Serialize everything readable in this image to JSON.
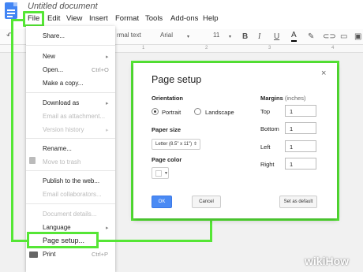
{
  "document": {
    "title": "Untitled document"
  },
  "menubar": [
    "File",
    "Edit",
    "View",
    "Insert",
    "Format",
    "Tools",
    "Add-ons",
    "Help"
  ],
  "toolbar": {
    "style": "rmal text",
    "font": "Arial",
    "size": "11"
  },
  "ruler": [
    "1",
    "2",
    "3",
    "4"
  ],
  "file_menu": {
    "items": [
      {
        "label": "Share...",
        "disabled": false
      },
      {
        "label": "New",
        "submenu": true
      },
      {
        "label": "Open...",
        "shortcut": "Ctrl+O"
      },
      {
        "label": "Make a copy..."
      },
      {
        "label": "Download as",
        "submenu": true
      },
      {
        "label": "Email as attachment...",
        "disabled": true
      },
      {
        "label": "Version history",
        "submenu": true,
        "disabled": true
      },
      {
        "label": "Rename..."
      },
      {
        "label": "Move to trash",
        "disabled": true
      },
      {
        "label": "Publish to the web..."
      },
      {
        "label": "Email collaborators...",
        "disabled": true
      },
      {
        "label": "Document details...",
        "disabled": true
      },
      {
        "label": "Language",
        "submenu": true
      },
      {
        "label": "Page setup..."
      },
      {
        "label": "Print",
        "shortcut": "Ctrl+P"
      }
    ]
  },
  "dialog": {
    "title": "Page setup",
    "orientation": {
      "label": "Orientation",
      "portrait": "Portrait",
      "landscape": "Landscape",
      "selected": "Portrait"
    },
    "paper_size": {
      "label": "Paper size",
      "value": "Letter (8.5\" x 11\")"
    },
    "page_color": {
      "label": "Page color",
      "value": "#ffffff"
    },
    "margins": {
      "label": "Margins",
      "unit": "(inches)",
      "top": {
        "label": "Top",
        "value": "1"
      },
      "bottom": {
        "label": "Bottom",
        "value": "1"
      },
      "left": {
        "label": "Left",
        "value": "1"
      },
      "right": {
        "label": "Right",
        "value": "1"
      }
    },
    "buttons": {
      "ok": "OK",
      "cancel": "Cancel",
      "default": "Set as default"
    },
    "close": "×"
  },
  "watermark": "wikiHow",
  "colors": {
    "highlight": "#55e635",
    "primary_button": "#4a8af4",
    "doc_icon": "#4285f4"
  }
}
